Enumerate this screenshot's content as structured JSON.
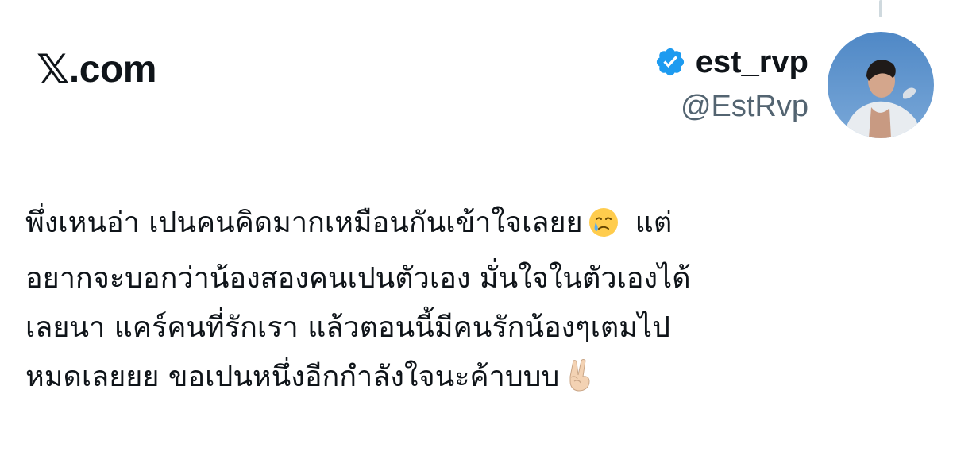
{
  "brand": {
    "mark": "𝕏",
    "text": ".com"
  },
  "author": {
    "display_name": "est_rvp",
    "handle": "@EstRvp",
    "verified_icon": "verified-badge-icon",
    "accent_color": "#1d9bf0"
  },
  "tweet": {
    "lines": [
      "พึ่งเหนอ่า เปนคนคิดมากเหมือนกันเข้าใจเลยย",
      "แต่",
      "อยากจะบอกว่าน้องสองคนเปนตัวเอง มั่นใจในตัวเองได้",
      "เลยนา แคร์คนที่รักเรา แล้วตอนนี้มีคนรักน้องๆเตมไป",
      "หมดเลยยย ขอเปนหนึ่งอีกกำลังใจนะค้าบบบ"
    ],
    "emoji_1": "face-holding-back-tears-icon",
    "emoji_2": "victory-hand-icon"
  },
  "colors": {
    "text": "#0f1419",
    "secondary": "#536471",
    "thread_line": "#cfd9de"
  }
}
